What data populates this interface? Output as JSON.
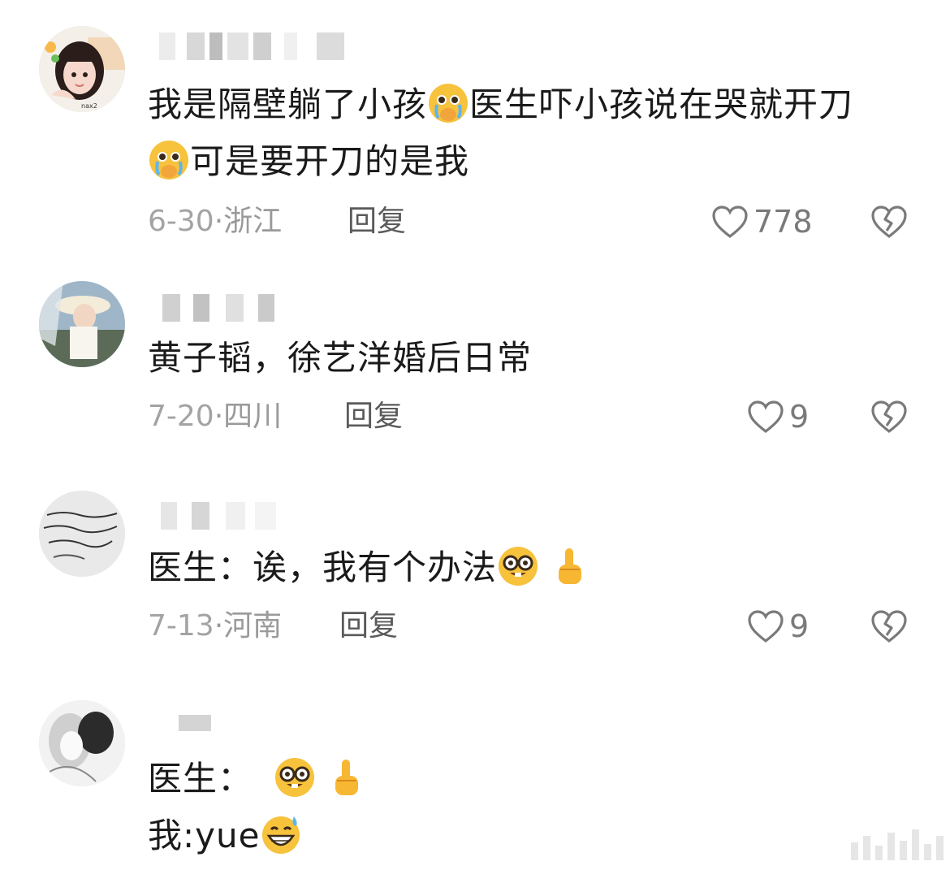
{
  "comments": [
    {
      "text_parts": [
        "我是隔壁躺了小孩",
        "医生吓小孩说在哭就开刀",
        "可是要开刀的是我"
      ],
      "emojis": [
        "crying-face-emoji",
        "crying-face-emoji"
      ],
      "date": "6-30",
      "location": "浙江",
      "reply_label": "回复",
      "likes": "778"
    },
    {
      "text_parts": [
        "黄子韬，徐艺洋婚后日常"
      ],
      "date": "7-20",
      "location": "四川",
      "reply_label": "回复",
      "likes": "9"
    },
    {
      "text_parts": [
        "医生：诶，我有个办法"
      ],
      "emojis": [
        "nerd-face-emoji",
        "pointing-up-emoji"
      ],
      "date": "7-13",
      "location": "河南",
      "reply_label": "回复",
      "likes": "9"
    },
    {
      "text_parts": [
        "医生：",
        "我:yue"
      ],
      "emojis": [
        "nerd-face-emoji",
        "pointing-up-emoji",
        "grinning-sweat-emoji"
      ]
    }
  ],
  "colors": {
    "text": "#1a1a1a",
    "meta": "#9a9a9a",
    "reply": "#5a5a5a",
    "icon": "#7a7a7a",
    "emoji_yellow": "#f7c23c"
  },
  "avatar_overlay_text": "nax2"
}
